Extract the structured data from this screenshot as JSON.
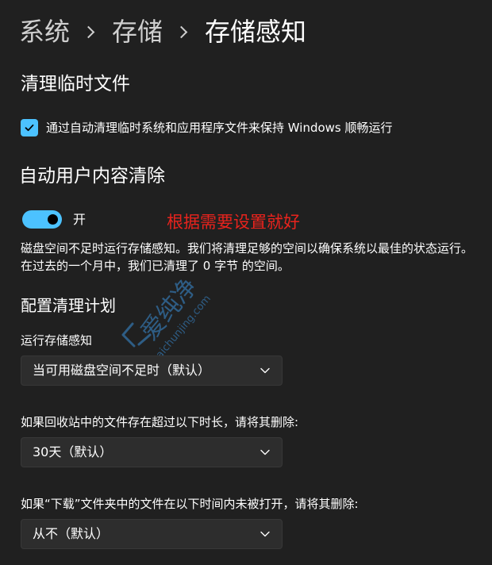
{
  "breadcrumb": {
    "items": [
      "系统",
      "存储"
    ],
    "current": "存储感知"
  },
  "temp_files": {
    "title": "清理临时文件",
    "checkbox_label": "通过自动清理临时系统和应用程序文件来保持 Windows 顺畅运行",
    "checked": true
  },
  "auto_cleanup": {
    "title": "自动用户内容清除",
    "toggle_label": "开",
    "toggle_on": true,
    "description": "磁盘空间不足时运行存储感知。我们将清理足够的空间以确保系统以最佳的状态运行。 在过去的一个月中，我们已清理了 0 字节 的空间。"
  },
  "annotation": {
    "text": "根据需要设置就好",
    "color": "#e8231d"
  },
  "schedule": {
    "title": "配置清理计划",
    "run_label": "运行存储感知",
    "run_value": "当可用磁盘空间不足时（默认）",
    "recycle_label": "如果回收站中的文件存在超过以下时长，请将其删除:",
    "recycle_value": "30天（默认）",
    "downloads_label": "如果“下载”文件夹中的文件在以下时间内未被打开，请将其删除:",
    "downloads_value": "从不（默认）"
  },
  "watermark": {
    "text": "爱纯净",
    "url_text": "aichunjing.com"
  },
  "colors": {
    "background": "#202020",
    "accent": "#4cc2ff",
    "control": "#2d2d2d",
    "annotation": "#e8231d"
  }
}
